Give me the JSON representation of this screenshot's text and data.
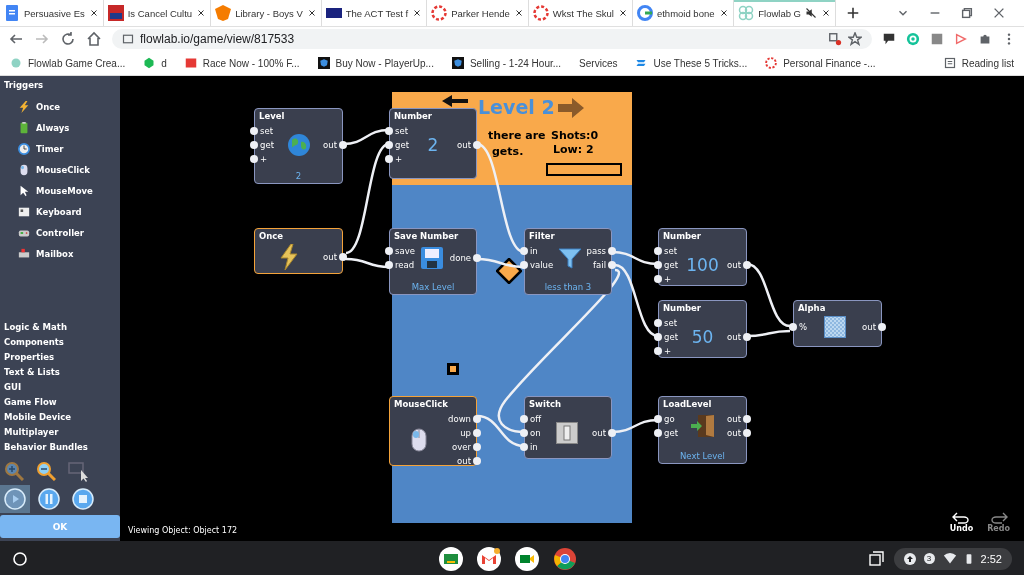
{
  "browser": {
    "tabs": [
      {
        "title": "Persuasive Es",
        "selected": false
      },
      {
        "title": "Is Cancel Cultu",
        "selected": false
      },
      {
        "title": "Library - Boys V",
        "selected": false
      },
      {
        "title": "The ACT Test f",
        "selected": false
      },
      {
        "title": "Parker Hende",
        "selected": false
      },
      {
        "title": "Wkst The Skul",
        "selected": false
      },
      {
        "title": "ethmoid bone",
        "selected": false
      },
      {
        "title": "Flowlab G",
        "selected": true
      }
    ],
    "address": "flowlab.io/game/view/817533",
    "bookmarks": [
      "Flowlab Game Crea...",
      "d",
      "Race Now - 100% F...",
      "Buy Now - PlayerUp...",
      "Selling -  1-24 Hour...",
      "Services",
      "Use These 5 Tricks...",
      "Personal Finance -..."
    ],
    "reading_list": "Reading list"
  },
  "sidebar": {
    "section": "Triggers",
    "triggers": [
      "Once",
      "Always",
      "Timer",
      "MouseClick",
      "MouseMove",
      "Keyboard",
      "Controller",
      "Mailbox"
    ],
    "categories": [
      "Logic & Math",
      "Components",
      "Properties",
      "Text & Lists",
      "GUI",
      "Game Flow",
      "Mobile Device",
      "Multiplayer",
      "Behavior Bundles"
    ],
    "playback": [
      {
        "selected": true
      },
      {
        "selected": false
      },
      {
        "selected": false
      }
    ],
    "ok": "OK"
  },
  "game_preview": {
    "title": "Level 2",
    "lines": [
      "there are",
      "gets."
    ],
    "shots": "Shots:0",
    "low": "Low: 2",
    "progress": {
      "level": 0
    }
  },
  "nodes": [
    {
      "title": "Level",
      "inputs": [
        "set",
        "get",
        "+"
      ],
      "outputs": [
        "out"
      ],
      "footer": "2",
      "highlighted": false
    },
    {
      "title": "Number",
      "inputs": [
        "set",
        "get",
        "+"
      ],
      "outputs": [
        "out"
      ],
      "value": "2",
      "highlighted": false
    },
    {
      "title": "Once",
      "outputs": [
        "out"
      ],
      "highlighted": true
    },
    {
      "title": "Save Number",
      "inputs": [
        "save",
        "read"
      ],
      "outputs": [
        "done"
      ],
      "footer": "Max Level",
      "highlighted": false
    },
    {
      "title": "Filter",
      "inputs": [
        "in",
        "value"
      ],
      "outputs": [
        "pass",
        "fail"
      ],
      "footer": "less than 3",
      "highlighted": false
    },
    {
      "title": "Number",
      "inputs": [
        "set",
        "get",
        "+"
      ],
      "outputs": [
        "out"
      ],
      "value": "100",
      "highlighted": false
    },
    {
      "title": "Number",
      "inputs": [
        "set",
        "get",
        "+"
      ],
      "outputs": [
        "out"
      ],
      "value": "50",
      "highlighted": false
    },
    {
      "title": "Alpha",
      "inputs": [
        "%"
      ],
      "outputs": [
        "out"
      ],
      "highlighted": false
    },
    {
      "title": "MouseClick",
      "outputs": [
        "down",
        "up",
        "over",
        "out"
      ],
      "highlighted": true
    },
    {
      "title": "Switch",
      "inputs": [
        "off",
        "on",
        "in"
      ],
      "outputs": [
        "out"
      ],
      "highlighted": false
    },
    {
      "title": "LoadLevel",
      "inputs": [
        "go",
        "get"
      ],
      "outputs": [
        "out",
        "out"
      ],
      "footer": "Next Level",
      "highlighted": false
    }
  ],
  "status": "Viewing Object: Object 172",
  "history": [
    {
      "label": "Undo",
      "disabled": false
    },
    {
      "label": "Redo",
      "disabled": true
    }
  ],
  "shelf": {
    "notifications": "3",
    "time": "2:52"
  }
}
